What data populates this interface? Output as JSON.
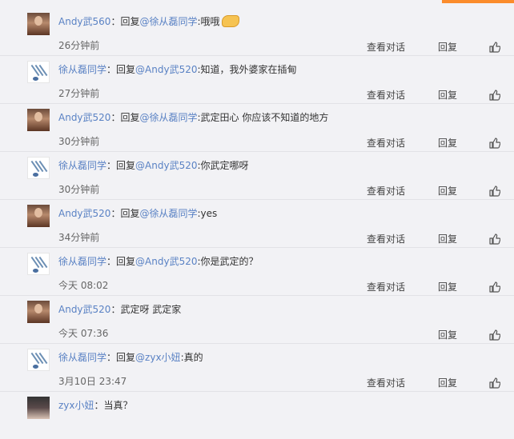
{
  "comments": [
    {
      "avatar": "andy-avatar",
      "user": "Andy武560",
      "colon": "：",
      "prefix": "回复",
      "mention": "@徐从磊同学",
      "text": ":哦哦",
      "emoji": "handshake-emoji",
      "time": "26分钟前",
      "dialog_label": "查看对话",
      "reply_label": "回复",
      "like_icon": "thumbs-up-icon"
    },
    {
      "avatar": "xu-avatar",
      "user": "徐从磊同学",
      "colon": "：",
      "prefix": "回复",
      "mention": "@Andy武520",
      "text": ":知道，我外婆家在插甸",
      "time": "27分钟前",
      "dialog_label": "查看对话",
      "reply_label": "回复",
      "like_icon": "thumbs-up-icon"
    },
    {
      "avatar": "andy-avatar",
      "user": "Andy武520",
      "colon": "：",
      "prefix": "回复",
      "mention": "@徐从磊同学",
      "text": ":武定田心 你应该不知道的地方",
      "time": "30分钟前",
      "dialog_label": "查看对话",
      "reply_label": "回复",
      "like_icon": "thumbs-up-icon"
    },
    {
      "avatar": "xu-avatar",
      "user": "徐从磊同学",
      "colon": "：",
      "prefix": "回复",
      "mention": "@Andy武520",
      "text": ":你武定哪呀",
      "time": "30分钟前",
      "dialog_label": "查看对话",
      "reply_label": "回复",
      "like_icon": "thumbs-up-icon"
    },
    {
      "avatar": "andy-avatar",
      "user": "Andy武520",
      "colon": "：",
      "prefix": "回复",
      "mention": "@徐从磊同学",
      "text": ":yes",
      "time": "34分钟前",
      "dialog_label": "查看对话",
      "reply_label": "回复",
      "like_icon": "thumbs-up-icon"
    },
    {
      "avatar": "xu-avatar",
      "user": "徐从磊同学",
      "colon": "：",
      "prefix": "回复",
      "mention": "@Andy武520",
      "text": ":你是武定的？",
      "time": "今天 08:02",
      "dialog_label": "查看对话",
      "reply_label": "回复",
      "like_icon": "thumbs-up-icon"
    },
    {
      "avatar": "andy-avatar",
      "user": "Andy武520",
      "colon": "：",
      "prefix": "",
      "mention": "",
      "text": "武定呀 武定家",
      "time": "今天 07:36",
      "dialog_label": "",
      "reply_label": "回复",
      "like_icon": "thumbs-up-icon"
    },
    {
      "avatar": "xu-avatar",
      "user": "徐从磊同学",
      "colon": "：",
      "prefix": "回复",
      "mention": "@zyx小妞",
      "text": ":真的",
      "time": "3月10日 23:47",
      "dialog_label": "查看对话",
      "reply_label": "回复",
      "like_icon": "thumbs-up-icon"
    },
    {
      "avatar": "zyx-avatar",
      "user": "zyx小妞",
      "colon": "：",
      "prefix": "",
      "mention": "",
      "text": "当真？",
      "time": "",
      "dialog_label": "",
      "reply_label": "",
      "like_icon": ""
    }
  ],
  "colors": {
    "link": "#5a82c4",
    "background": "#f2f2f5",
    "accent": "#fb8c2c"
  }
}
